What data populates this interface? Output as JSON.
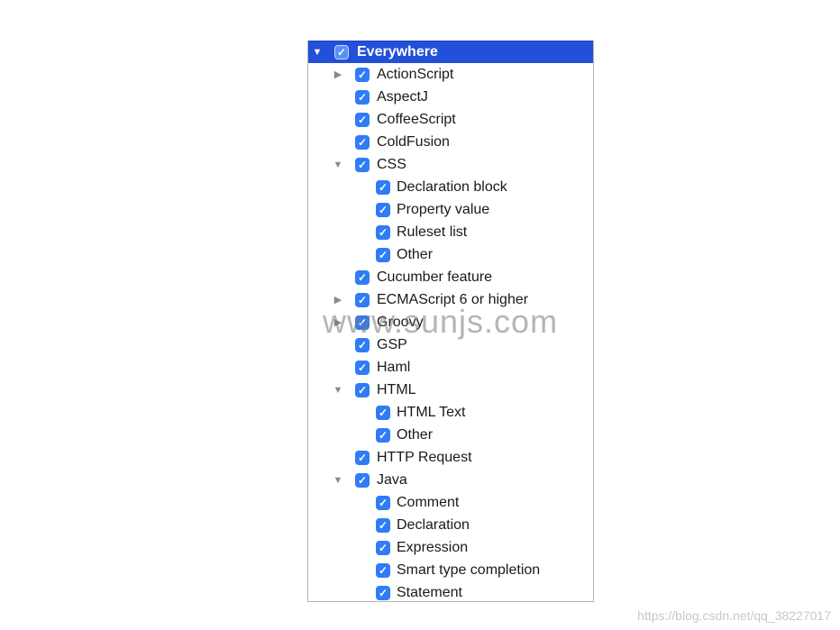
{
  "tree": [
    {
      "label": "Everywhere",
      "level": 0,
      "expander": "expanded",
      "checked": true,
      "selected": true
    },
    {
      "label": "ActionScript",
      "level": 1,
      "expander": "collapsed",
      "checked": true
    },
    {
      "label": "AspectJ",
      "level": 1,
      "expander": "none",
      "checked": true
    },
    {
      "label": "CoffeeScript",
      "level": 1,
      "expander": "none",
      "checked": true
    },
    {
      "label": "ColdFusion",
      "level": 1,
      "expander": "none",
      "checked": true
    },
    {
      "label": "CSS",
      "level": 1,
      "expander": "expanded",
      "checked": true
    },
    {
      "label": "Declaration block",
      "level": 2,
      "expander": "none",
      "checked": true
    },
    {
      "label": "Property value",
      "level": 2,
      "expander": "none",
      "checked": true
    },
    {
      "label": "Ruleset list",
      "level": 2,
      "expander": "none",
      "checked": true
    },
    {
      "label": "Other",
      "level": 2,
      "expander": "none",
      "checked": true
    },
    {
      "label": "Cucumber feature",
      "level": 1,
      "expander": "none",
      "checked": true
    },
    {
      "label": "ECMAScript 6 or higher",
      "level": 1,
      "expander": "collapsed",
      "checked": true
    },
    {
      "label": "Groovy",
      "level": 1,
      "expander": "collapsed",
      "checked": true
    },
    {
      "label": "GSP",
      "level": 1,
      "expander": "none",
      "checked": true
    },
    {
      "label": "Haml",
      "level": 1,
      "expander": "none",
      "checked": true
    },
    {
      "label": "HTML",
      "level": 1,
      "expander": "expanded",
      "checked": true
    },
    {
      "label": "HTML Text",
      "level": 2,
      "expander": "none",
      "checked": true
    },
    {
      "label": "Other",
      "level": 2,
      "expander": "none",
      "checked": true
    },
    {
      "label": "HTTP Request",
      "level": 1,
      "expander": "none",
      "checked": true
    },
    {
      "label": "Java",
      "level": 1,
      "expander": "expanded",
      "checked": true
    },
    {
      "label": "Comment",
      "level": 2,
      "expander": "none",
      "checked": true
    },
    {
      "label": "Declaration",
      "level": 2,
      "expander": "none",
      "checked": true
    },
    {
      "label": "Expression",
      "level": 2,
      "expander": "none",
      "checked": true
    },
    {
      "label": "Smart type completion",
      "level": 2,
      "expander": "none",
      "checked": true
    },
    {
      "label": "Statement",
      "level": 2,
      "expander": "none",
      "checked": true
    }
  ],
  "watermark": "www.sunjs.com",
  "credit": "https://blog.csdn.net/qq_38227017",
  "colors": {
    "selection": "#2350d8",
    "checkbox": "#2f7cf6"
  }
}
